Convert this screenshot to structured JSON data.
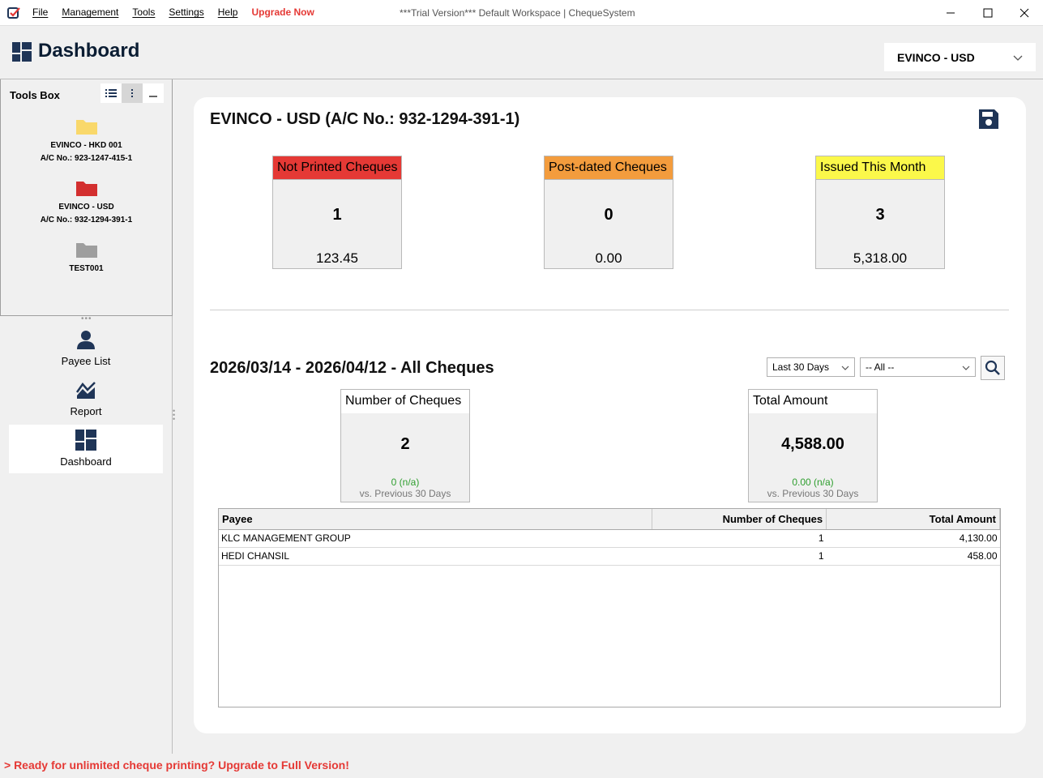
{
  "app": {
    "window_title": "***Trial Version*** Default Workspace | ChequeSystem",
    "menu": [
      "File",
      "Management",
      "Tools",
      "Settings",
      "Help"
    ],
    "upgrade_label": "Upgrade Now"
  },
  "header": {
    "title": "Dashboard",
    "account_selector": "EVINCO - USD"
  },
  "toolsbox": {
    "title": "Tools Box",
    "accounts": [
      {
        "name": "EVINCO - HKD 001",
        "acno": "A/C No.: 923-1247-415-1",
        "icon": "folder-yellow-icon",
        "color": "#f9d86b"
      },
      {
        "name": "EVINCO - USD",
        "acno": "A/C No.: 932-1294-391-1",
        "icon": "folder-red-icon",
        "color": "#d32f2f"
      },
      {
        "name": "TEST001",
        "acno": "",
        "icon": "folder-gray-icon",
        "color": "#9e9e9e"
      }
    ]
  },
  "nav": [
    {
      "label": "Payee List",
      "icon": "person-icon"
    },
    {
      "label": "Report",
      "icon": "report-chart-icon"
    },
    {
      "label": "Dashboard",
      "icon": "dashboard-icon"
    }
  ],
  "account_summary": {
    "heading": "EVINCO - USD (A/C No.: 932-1294-391-1)",
    "cards": [
      {
        "title": "Not Printed Cheques",
        "count": "1",
        "amount": "123.45",
        "color": "#e53935"
      },
      {
        "title": "Post-dated Cheques",
        "count": "0",
        "amount": "0.00",
        "color": "#f39c3d"
      },
      {
        "title": "Issued This Month",
        "count": "3",
        "amount": "5,318.00",
        "color": "#fbf84a"
      }
    ]
  },
  "period": {
    "heading": "2026/03/14 - 2026/04/12 - All Cheques",
    "range_select": "Last 30 Days",
    "filter_select": "-- All --",
    "number_card": {
      "title": "Number of Cheques",
      "value": "2",
      "change": "0 (n/a)",
      "compare": "vs. Previous 30 Days"
    },
    "amount_card": {
      "title": "Total Amount",
      "value": "4,588.00",
      "change": "0.00 (n/a)",
      "compare": "vs. Previous 30 Days"
    }
  },
  "table": {
    "columns": [
      "Payee",
      "Number of Cheques",
      "Total Amount"
    ],
    "rows": [
      [
        "KLC MANAGEMENT GROUP",
        "1",
        "4,130.00"
      ],
      [
        "HEDI CHANSIL",
        "1",
        "458.00"
      ]
    ]
  },
  "status": {
    "message": "> Ready for unlimited cheque printing? Upgrade to Full Version!"
  },
  "colors": {
    "brand_dark": "#1f3557",
    "accent_red": "#e53935"
  }
}
